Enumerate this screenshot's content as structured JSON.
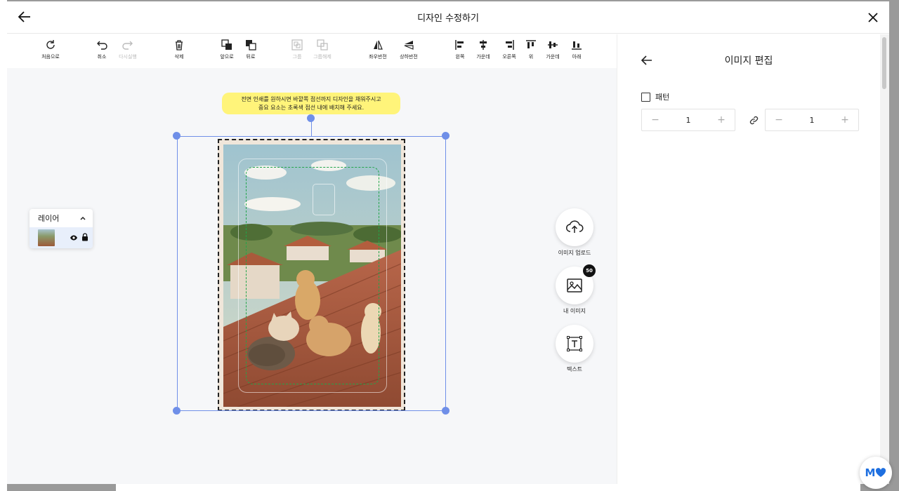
{
  "header": {
    "title": "디자인 수정하기"
  },
  "toolbar": {
    "reset": "처음으로",
    "undo": "취소",
    "redo": "다시실행",
    "delete": "삭제",
    "front": "앞으로",
    "back": "뒤로",
    "group": "그룹",
    "ungroup": "그룹해제",
    "flip_h": "좌우반전",
    "flip_v": "상하반전",
    "align_left": "왼쪽",
    "align_center": "가운데",
    "align_right": "오른쪽",
    "align_top": "위",
    "align_middle": "가운데",
    "align_bottom": "아래"
  },
  "layer_panel": {
    "title": "레이어"
  },
  "tooltip": {
    "line1": "전면 인쇄를 원하시면 바깥쪽 점선까지 디자인을 채워주시고",
    "line2": "중요 요소는 초록색 점선 내에 배치해 주세요."
  },
  "side_buttons": {
    "upload": "이미지 업로드",
    "my_images": "내 이미지",
    "my_images_count": "50",
    "text": "텍스트"
  },
  "right_panel": {
    "title": "이미지 편집",
    "pattern_label": "패턴",
    "pattern_x": "1",
    "pattern_y": "1"
  },
  "chat": {
    "label": "M"
  },
  "colors": {
    "accent": "#6f8fe8",
    "safe_line": "#21a54a",
    "tooltip_bg": "#fff47a"
  }
}
